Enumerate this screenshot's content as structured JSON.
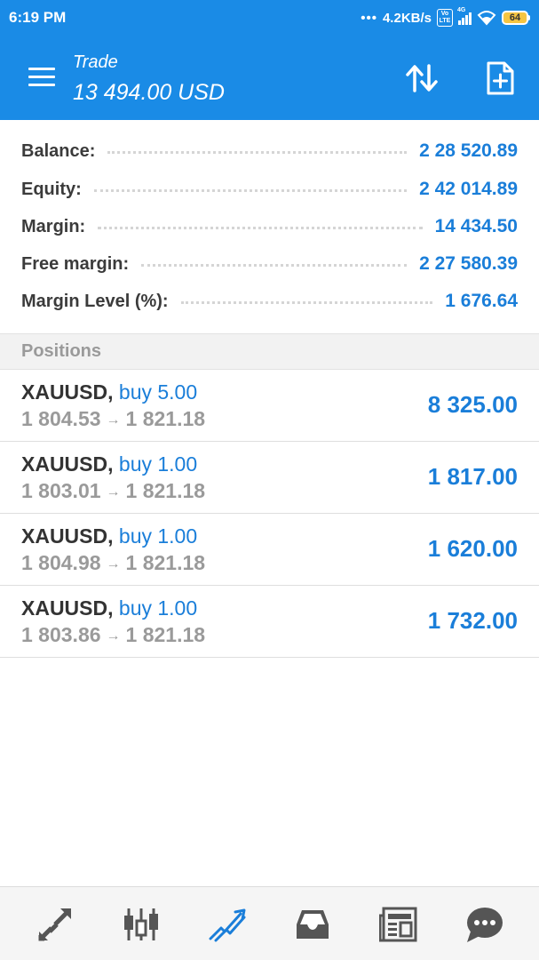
{
  "status_bar": {
    "time": "6:19 PM",
    "network_speed": "4.2KB/s",
    "volte_label": "Vo LTE",
    "signal_label": "4G",
    "battery": "64"
  },
  "app_bar": {
    "title": "Trade",
    "balance": "13 494.00 USD",
    "icons": [
      "menu-icon",
      "sort-icon",
      "new-order-icon"
    ]
  },
  "summary": {
    "rows": [
      {
        "label": "Balance:",
        "value": "2 28 520.89"
      },
      {
        "label": "Equity:",
        "value": "2 42 014.89"
      },
      {
        "label": "Margin:",
        "value": "14 434.50"
      },
      {
        "label": "Free margin:",
        "value": "2 27 580.39"
      },
      {
        "label": "Margin Level (%):",
        "value": "1 676.64"
      }
    ]
  },
  "positions": {
    "header": "Positions",
    "items": [
      {
        "symbol": "XAUUSD,",
        "type": "buy 5.00",
        "open_price": "1 804.53",
        "arrow": "→",
        "current_price": "1 821.18",
        "profit": "8 325.00"
      },
      {
        "symbol": "XAUUSD,",
        "type": "buy 1.00",
        "open_price": "1 803.01",
        "arrow": "→",
        "current_price": "1 821.18",
        "profit": "1 817.00"
      },
      {
        "symbol": "XAUUSD,",
        "type": "buy 1.00",
        "open_price": "1 804.98",
        "arrow": "→",
        "current_price": "1 821.18",
        "profit": "1 620.00"
      },
      {
        "symbol": "XAUUSD,",
        "type": "buy 1.00",
        "open_price": "1 803.86",
        "arrow": "→",
        "current_price": "1 821.18",
        "profit": "1 732.00"
      }
    ]
  },
  "bottom_nav": {
    "items": [
      "quotes-icon",
      "chart-icon",
      "trade-icon",
      "history-icon",
      "news-icon",
      "chat-icon"
    ],
    "active": "trade-icon"
  },
  "colors": {
    "header_bg": "#1a8be6",
    "accent_blue": "#1a7ed9",
    "label_dark": "#3b3b3b",
    "muted_gray": "#9a9a9a",
    "nav_icon_gray": "#555555"
  }
}
